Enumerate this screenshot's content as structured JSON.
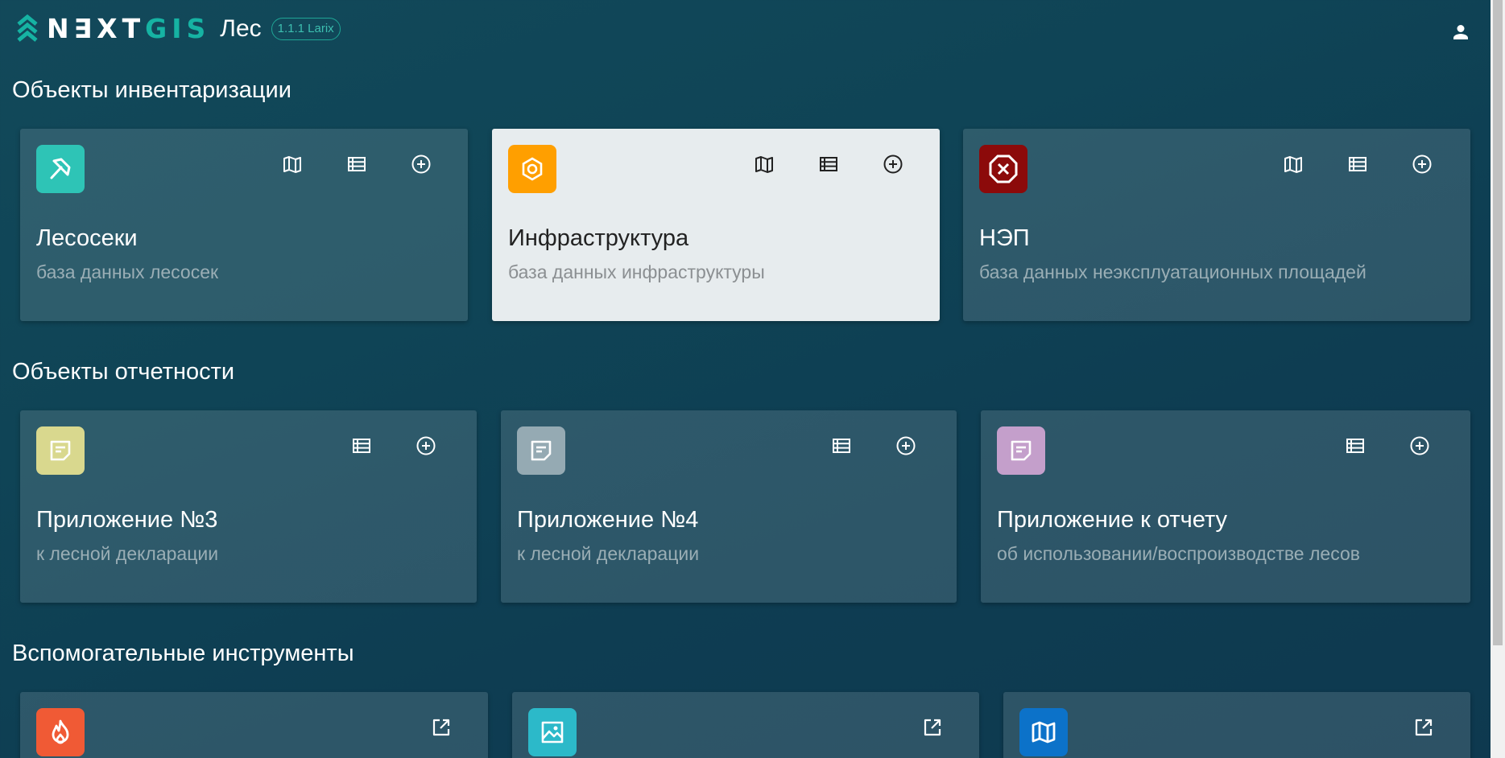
{
  "header": {
    "logo_main": "N∃XT",
    "logo_accent": "GIS",
    "app_name": "Лес",
    "version": "1.1.1 Larix"
  },
  "colors": {
    "accent": "#16b3a3",
    "lesoseki": "#2ec4b6",
    "infrastructure": "#ff9f00",
    "nep": "#8c0a0a",
    "app3": "#d9d88e",
    "app4": "#95aab3",
    "report": "#c49fcb",
    "fire": "#f05a35",
    "image": "#2cb9c9",
    "map": "#0c72c9"
  },
  "sections": {
    "inventory": "Объекты инвентаризации",
    "reports": "Объекты отчетности",
    "tools": "Вспомогательные инструменты"
  },
  "cards": {
    "lesoseki": {
      "title": "Лесосеки",
      "subtitle": "база данных лесосек",
      "icon": "axe-icon"
    },
    "infrastructure": {
      "title": "Инфраструктура",
      "subtitle": "база данных инфраструктуры",
      "icon": "gear-icon"
    },
    "nep": {
      "title": "НЭП",
      "subtitle": "база данных неэксплуатационных площадей",
      "icon": "stop-icon"
    },
    "app3": {
      "title": "Приложение №3",
      "subtitle": "к лесной декларации",
      "icon": "note-icon"
    },
    "app4": {
      "title": "Приложение №4",
      "subtitle": "к лесной декларации",
      "icon": "note-icon"
    },
    "report": {
      "title": "Приложение к отчету",
      "subtitle": "об использовании/воспроизводстве лесов",
      "icon": "note-icon"
    },
    "fire": {
      "icon": "fire-icon"
    },
    "image": {
      "icon": "image-icon"
    },
    "map": {
      "icon": "map-icon"
    }
  }
}
